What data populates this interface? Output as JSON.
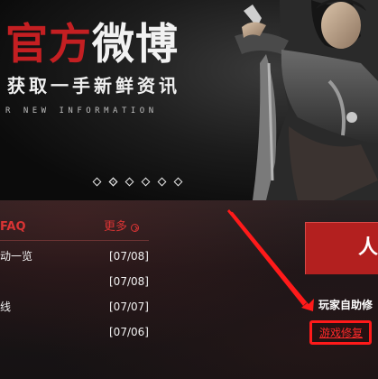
{
  "banner": {
    "title_red": "官方",
    "title_white": "微博",
    "subtitle": "获取一手新鲜资讯",
    "tagline": "R NEW INFORMATION",
    "slide_count": 6,
    "active_slide": 2
  },
  "faq": {
    "title": "FAQ",
    "more_label": "更多",
    "items": [
      {
        "title": "动一览",
        "date": "[07/08]"
      },
      {
        "title": "",
        "date": "[07/08]"
      },
      {
        "title": "线",
        "date": "[07/07]"
      },
      {
        "title": "",
        "date": "[07/06]"
      }
    ]
  },
  "sidebar": {
    "promo_text": "人",
    "self_repair_label": "玩家自助修",
    "repair_button_label": "游戏修复"
  },
  "colors": {
    "accent_red": "#d93434",
    "annotation_red": "#ff1a1a",
    "promo_red": "#b3201f"
  }
}
